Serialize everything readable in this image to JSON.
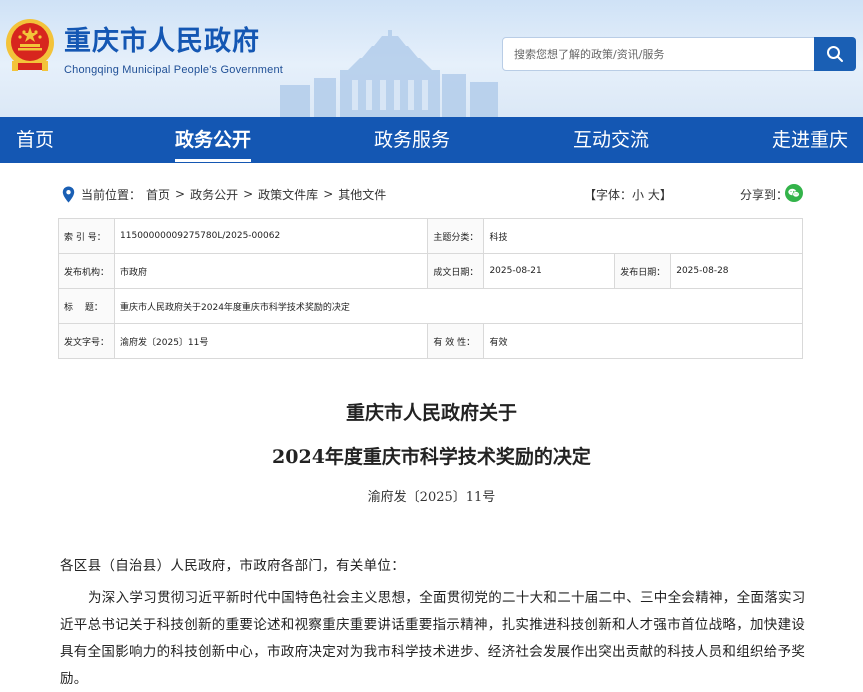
{
  "header": {
    "title": "重庆市人民政府",
    "subtitle": "Chongqing Municipal People's Government",
    "search_placeholder": "搜索您想了解的政策/资讯/服务",
    "colors": {
      "brand": "#1457b3",
      "emblem_red": "#d7261e",
      "emblem_gold": "#f3c33a"
    }
  },
  "nav": {
    "items": [
      {
        "label": "首页",
        "active": false
      },
      {
        "label": "政务公开",
        "active": true
      },
      {
        "label": "政务服务",
        "active": false
      },
      {
        "label": "互动交流",
        "active": false
      },
      {
        "label": "走进重庆",
        "active": false
      }
    ]
  },
  "breadcrumb": {
    "prefix": "当前位置：",
    "items": [
      "首页",
      "政务公开",
      "政策文件库",
      "其他文件"
    ],
    "separator": ">",
    "icon": "location-pin-icon"
  },
  "font_control": {
    "label": "【字体：",
    "small": "小",
    "large": "大",
    "suffix": "】"
  },
  "share": {
    "label": "分享到：",
    "icon": "wechat-icon"
  },
  "meta": {
    "index_label": "索 引 号：",
    "index_value": "11500000009275780L/2025-00062",
    "topic_label": "主题分类：",
    "topic_value": "科技",
    "issuer_label": "发布机构：",
    "issuer_value": "市政府",
    "created_label": "成文日期：",
    "created_value": "2025-08-21",
    "published_label": "发布日期：",
    "published_value": "2025-08-28",
    "title_label": "标　 题：",
    "title_value": "重庆市人民政府关于2024年度重庆市科学技术奖励的决定",
    "docno_label": "发文字号：",
    "docno_value": "渝府发〔2025〕11号",
    "validity_label": "有 效 性：",
    "validity_value": "有效"
  },
  "document": {
    "title_line1": "重庆市人民政府关于",
    "title_line2": "2024年度重庆市科学技术奖励的决定",
    "doc_number": "渝府发〔2025〕11号",
    "salutation": "各区县（自治县）人民政府，市政府各部门，有关单位：",
    "paragraph1": "为深入学习贯彻习近平新时代中国特色社会主义思想，全面贯彻党的二十大和二十届二中、三中全会精神，全面落实习近平总书记关于科技创新的重要论述和视察重庆重要讲话重要指示精神，扎实推进科技创新和人才强市首位战略，加快建设具有全国影响力的科技创新中心，市政府决定对为我市科学技术进步、经济社会发展作出突出贡献的科技人员和组织给予奖励。"
  }
}
